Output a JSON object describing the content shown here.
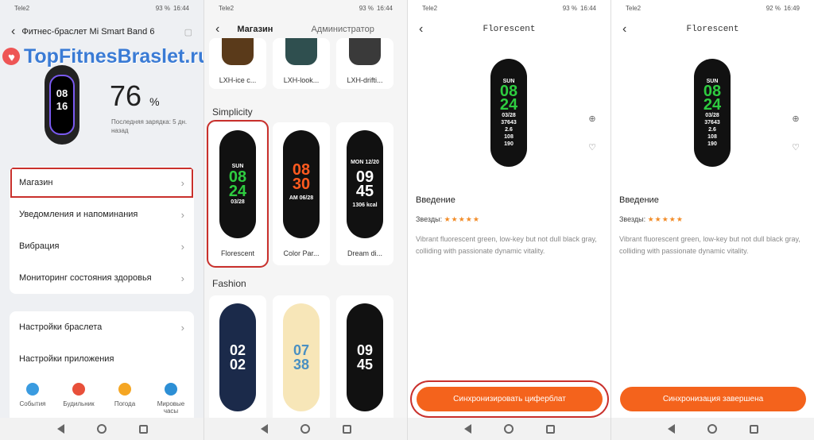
{
  "colors": {
    "accent": "#f4631c",
    "highlight": "#c9302c",
    "watermark": "#3a7bd5"
  },
  "panel1": {
    "status": {
      "carrier": "Tele2",
      "right": "93 %",
      "time": "16:44"
    },
    "header": {
      "title": "Фитнес-браслет Mi Smart Band 6"
    },
    "watermark": "TopFitnesBraslet.ru",
    "battery": {
      "value": "76",
      "unit": "%",
      "last_charge": "Последняя зарядка: 5 дн. назад"
    },
    "band_screen": "08\n16",
    "menu": [
      {
        "label": "Магазин",
        "chevron": "›"
      },
      {
        "label": "Уведомления и напоминания",
        "chevron": "›"
      },
      {
        "label": "Вибрация",
        "chevron": "›"
      },
      {
        "label": "Мониторинг состояния здоровья",
        "chevron": "›"
      }
    ],
    "menu2": [
      {
        "label": "Настройки браслета",
        "chevron": "›"
      },
      {
        "label": "Настройки приложения",
        "chevron": ""
      }
    ],
    "quick": [
      {
        "label": "События",
        "icon": "lightbulb-icon",
        "color": "#3a9be0"
      },
      {
        "label": "Будильник",
        "icon": "alarm-icon",
        "color": "#e8503a"
      },
      {
        "label": "Погода",
        "icon": "sun-icon",
        "color": "#f5a623"
      },
      {
        "label": "Мировые часы",
        "icon": "globe-icon",
        "color": "#2d8fd5"
      }
    ]
  },
  "panel2": {
    "status": {
      "carrier": "Tele2",
      "right": "93 %",
      "time": "16:44"
    },
    "tabs": {
      "active": "Магазин",
      "other": "Администратор"
    },
    "top_row": [
      "LXH-ice c...",
      "LXH-look...",
      "LXH-drifti..."
    ],
    "section1": "Simplicity",
    "simplicity": [
      {
        "name": "Florescent",
        "line1": "SUN",
        "line2": "08",
        "line3": "24",
        "line4": "03/28"
      },
      {
        "name": "Color Par...",
        "line1": "",
        "line2": "08",
        "line3": "30",
        "line4": "AM 06/28"
      },
      {
        "name": "Dream di...",
        "line1": "MON 12/20",
        "line2": "09",
        "line3": "45",
        "line4": "1306 kcal"
      }
    ],
    "section2": "Fashion",
    "fashion": [
      {
        "line1": "02",
        "line2": "02"
      },
      {
        "line1": "07",
        "line2": "38"
      },
      {
        "line1": "09",
        "line2": "45"
      }
    ]
  },
  "panel3": {
    "status": {
      "carrier": "Tele2",
      "right": "93 %",
      "time": "16:44"
    },
    "title": "Florescent",
    "watch": {
      "day": "SUN",
      "h": "08",
      "m": "24",
      "date": "03/28",
      "s1": "37643",
      "s2": "2.6",
      "s3": "108",
      "s4": "190"
    },
    "intro": "Введение",
    "stars_label": "Звезды:",
    "stars": "★★★★★",
    "description": "Vibrant fluorescent green, low-key but not dull black gray, colliding with passionate dynamic vitality.",
    "button": "Синхронизировать циферблат"
  },
  "panel4": {
    "status": {
      "carrier": "Tele2",
      "right": "92 %",
      "time": "16:49"
    },
    "title": "Florescent",
    "intro": "Введение",
    "stars_label": "Звезды:",
    "stars": "★★★★★",
    "description": "Vibrant fluorescent green, low-key but not dull black gray, colliding with passionate dynamic vitality.",
    "button": "Синхронизация завершена"
  }
}
